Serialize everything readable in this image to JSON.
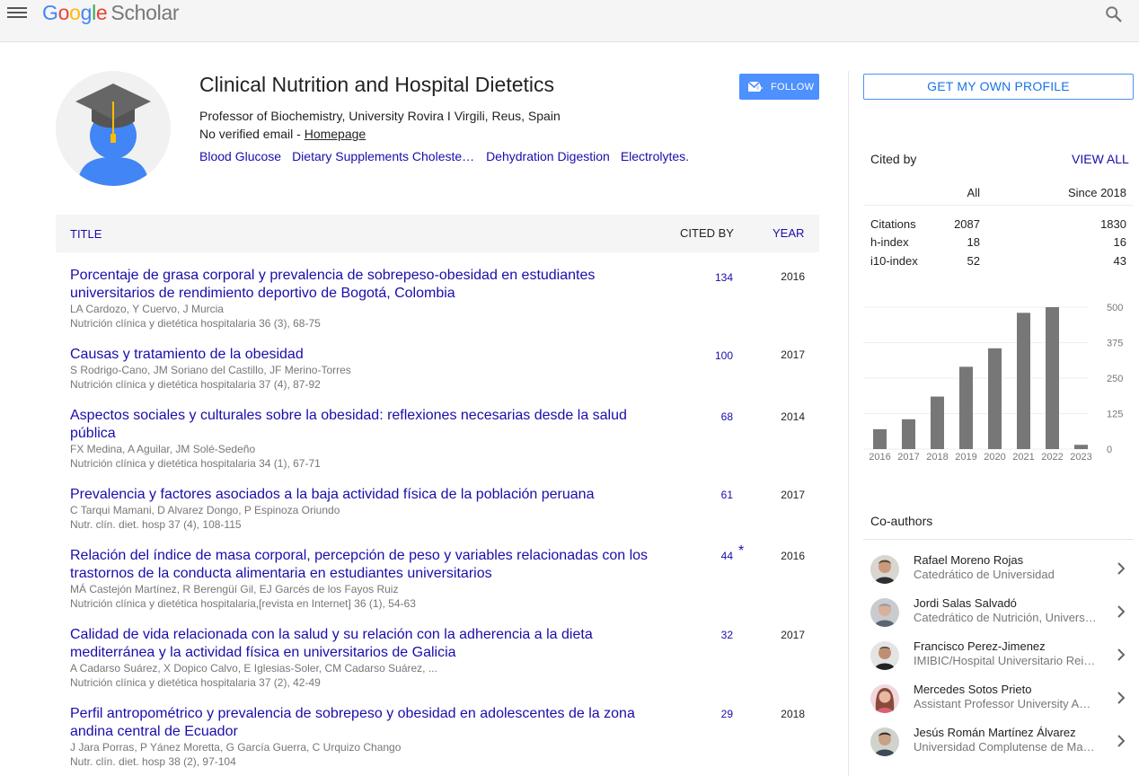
{
  "app": {
    "logo_google": "Google",
    "logo_scholar": "Scholar"
  },
  "profile": {
    "name": "Clinical Nutrition and Hospital Dietetics",
    "affiliation": "Professor of Biochemistry, University Rovira I Virgili, Reus, Spain",
    "email_text": "No verified email - ",
    "homepage_label": "Homepage",
    "follow_label": "FOLLOW",
    "interests": [
      "Blood Glucose",
      "Dietary Supplements Cholesterol",
      "Dehydration Digestion",
      "Electrolytes."
    ]
  },
  "table": {
    "col_title": "TITLE",
    "col_cited": "CITED BY",
    "col_year": "YEAR",
    "rows": [
      {
        "title": "Porcentaje de grasa corporal y prevalencia de sobrepeso-obesidad en estudiantes universitarios de rendimiento deportivo de Bogotá, Colombia",
        "authors": "LA Cardozo, Y Cuervo, J Murcia",
        "venue": "Nutrición clínica y dietética hospitalaria 36 (3), 68-75",
        "cited": "134",
        "year": "2016",
        "star": ""
      },
      {
        "title": "Causas y tratamiento de la obesidad",
        "authors": "S Rodrigo-Cano, JM Soriano del Castillo, JF Merino-Torres",
        "venue": "Nutrición clínica y dietética hospitalaria 37 (4), 87-92",
        "cited": "100",
        "year": "2017",
        "star": ""
      },
      {
        "title": "Aspectos sociales y culturales sobre la obesidad: reflexiones necesarias desde la salud pública",
        "authors": "FX Medina, A Aguilar, JM Solé-Sedeño",
        "venue": "Nutrición clínica y dietética hospitalaria 34 (1), 67-71",
        "cited": "68",
        "year": "2014",
        "star": ""
      },
      {
        "title": "Prevalencia y factores asociados a la baja actividad física de la población peruana",
        "authors": "C Tarqui Mamani, D Alvarez Dongo, P Espinoza Oriundo",
        "venue": "Nutr. clín. diet. hosp 37 (4), 108-115",
        "cited": "61",
        "year": "2017",
        "star": ""
      },
      {
        "title": "Relación del índice de masa corporal, percepción de peso y variables relacionadas con los trastornos de la conducta alimentaria en estudiantes universitarios",
        "authors": "MÁ Castejón Martínez, R Berengüí Gil, EJ Garcés de los Fayos Ruiz",
        "venue": "Nutrición clínica y dietética hospitalaria,[revista en Internet] 36 (1), 54-63",
        "cited": "44",
        "year": "2016",
        "star": "*"
      },
      {
        "title": "Calidad de vida relacionada con la salud y su relación con la adherencia a la dieta mediterránea y la actividad física en universitarios de Galicia",
        "authors": "A Cadarso Suárez, X Dopico Calvo, E Iglesias-Soler, CM Cadarso Suárez, ...",
        "venue": "Nutrición clínica y dietética hospitalaria 37 (2), 42-49",
        "cited": "32",
        "year": "2017",
        "star": ""
      },
      {
        "title": "Perfil antropométrico y prevalencia de sobrepeso y obesidad en adolescentes de la zona andina central de Ecuador",
        "authors": "J Jara Porras, P Yánez Moretta, G García Guerra, C Urquizo Chango",
        "venue": "Nutr. clín. diet. hosp 38 (2), 97-104",
        "cited": "29",
        "year": "2018",
        "star": ""
      }
    ]
  },
  "sidebar": {
    "get_profile": "GET MY OWN PROFILE",
    "cited_by": "Cited by",
    "view_all": "VIEW ALL",
    "col_all": "All",
    "col_since": "Since 2018",
    "stats": [
      {
        "label": "Citations",
        "all": "2087",
        "since": "1830"
      },
      {
        "label": "h-index",
        "all": "18",
        "since": "16"
      },
      {
        "label": "i10-index",
        "all": "52",
        "since": "43"
      }
    ],
    "coauthors_title": "Co-authors",
    "coauthors": [
      {
        "name": "Rafael Moreno Rojas",
        "desc": "Catedrático de Universidad"
      },
      {
        "name": "Jordi Salas Salvadó",
        "desc": "Catedrático de Nutrición, Universitat Rovira i Virgili"
      },
      {
        "name": "Francisco Perez-Jimenez",
        "desc": "IMIBIC/Hospital Universitario Reina Sofia"
      },
      {
        "name": "Mercedes Sotos Prieto",
        "desc": "Assistant Professor University Autónoma de Madrid"
      },
      {
        "name": "Jesús Román Martínez Álvarez",
        "desc": "Universidad Complutense de Madrid"
      }
    ]
  },
  "chart_data": {
    "type": "bar",
    "categories": [
      "2016",
      "2017",
      "2018",
      "2019",
      "2020",
      "2021",
      "2022",
      "2023"
    ],
    "values": [
      70,
      105,
      185,
      290,
      355,
      480,
      500,
      15
    ],
    "ylim": [
      0,
      500
    ],
    "yticks": [
      "500",
      "375",
      "250",
      "125",
      "0"
    ],
    "bar_color": "#777777"
  }
}
